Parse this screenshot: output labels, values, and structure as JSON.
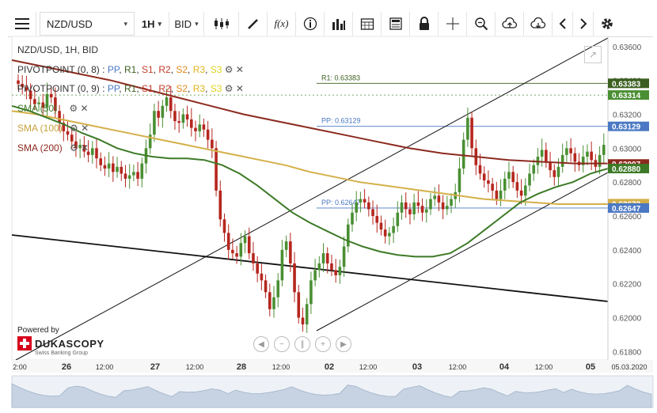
{
  "toolbar": {
    "symbol": "NZD/USD",
    "timeframe": "1H",
    "price_side": "BID",
    "fx_label": "f(x)",
    "buttons": [
      "menu-icon",
      "candles-icon",
      "pencil-icon",
      "fx-icon",
      "info-icon",
      "bars-icon",
      "calendar-icon",
      "report-icon",
      "lock-icon",
      "crosshair-icon",
      "zoom-icon",
      "upload-icon",
      "download-icon",
      "prev-icon",
      "next-icon",
      "settings-icon"
    ]
  },
  "legend": {
    "instrument": "NZD/USD, 1H, BID",
    "pivot1": {
      "name": "PIVOTPOINT (0, 8)",
      "items": [
        "PP",
        "R1",
        "S1",
        "R2",
        "S2",
        "R3",
        "S3"
      ]
    },
    "pivot2": {
      "name": "PIVOTPOINT (0, 9)",
      "items": [
        "PP",
        "R1",
        "S1",
        "R2",
        "S2",
        "R3",
        "S3"
      ]
    },
    "sma50": "SMA (50)",
    "sma100": "SMA (100)",
    "sma200": "SMA (200)"
  },
  "branding": {
    "powered_by": "Powered by",
    "name": "DUKASCOPY",
    "tagline": "Swiss Banking Group"
  },
  "colors": {
    "up": "#4a8f33",
    "down": "#b5261e",
    "sma50": "#3d7a27",
    "sma100": "#d4b04a",
    "sma200": "#8c2a1e",
    "pivot": "#4a78c4",
    "r1": "#3a5f1e"
  },
  "chart_data": {
    "type": "candlestick",
    "title": "NZD/USD, 1H, BID",
    "ylim": [
      0.6175,
      0.6366
    ],
    "yticks": [
      "0.63600",
      "0.63400",
      "0.63200",
      "0.63000",
      "0.62800",
      "0.62600",
      "0.62400",
      "0.62200",
      "0.62000",
      "0.61800"
    ],
    "xticks": [
      "2:00",
      "26",
      "12:00",
      "27",
      "12:00",
      "28",
      "12:00",
      "02",
      "12:00",
      "03",
      "12:00",
      "04",
      "12:00",
      "05",
      "05.03.2020"
    ],
    "price_tags": [
      {
        "value": "0.63383",
        "color": "#3a5f1e"
      },
      {
        "value": "0.63314",
        "color": "#4a8f33"
      },
      {
        "value": "0.63129",
        "color": "#4a78c4"
      },
      {
        "value": "0.62907",
        "color": "#8c2a1e"
      },
      {
        "value": "0.62880",
        "color": "#3d7a27"
      },
      {
        "value": "0.62673",
        "color": "#d4b04a"
      },
      {
        "value": "0.62647",
        "color": "#4a78c4"
      }
    ],
    "levels": [
      {
        "label": "R1: 0.63383",
        "value": 0.63383
      },
      {
        "label": "PP: 0.63129",
        "value": 0.63129
      },
      {
        "label": "PP: 0.62647",
        "value": 0.62647
      }
    ],
    "current_price": 0.63314,
    "closes": [
      0.6338,
      0.6336,
      0.6334,
      0.6329,
      0.6326,
      0.6327,
      0.6324,
      0.6332,
      0.633,
      0.6322,
      0.6315,
      0.631,
      0.6308,
      0.6304,
      0.63,
      0.6302,
      0.6298,
      0.6296,
      0.63,
      0.6294,
      0.629,
      0.6288,
      0.6291,
      0.6286,
      0.6289,
      0.6285,
      0.6282,
      0.6284,
      0.6286,
      0.6282,
      0.6291,
      0.63,
      0.6308,
      0.6322,
      0.6318,
      0.6325,
      0.633,
      0.6322,
      0.6316,
      0.6315,
      0.632,
      0.6317,
      0.6312,
      0.631,
      0.6314,
      0.6311,
      0.6305,
      0.63,
      0.6275,
      0.6258,
      0.625,
      0.624,
      0.6238,
      0.6236,
      0.6244,
      0.6248,
      0.6238,
      0.6232,
      0.6226,
      0.6222,
      0.6215,
      0.6205,
      0.6212,
      0.6222,
      0.624,
      0.6245,
      0.6232,
      0.6215,
      0.62,
      0.6196,
      0.6208,
      0.6222,
      0.6228,
      0.6232,
      0.6238,
      0.6232,
      0.6228,
      0.6225,
      0.623,
      0.6242,
      0.6255,
      0.6262,
      0.6268,
      0.627,
      0.6268,
      0.6264,
      0.626,
      0.6256,
      0.6252,
      0.6248,
      0.625,
      0.6254,
      0.6262,
      0.6268,
      0.6264,
      0.6261,
      0.6268,
      0.6266,
      0.6262,
      0.6264,
      0.627,
      0.6272,
      0.6268,
      0.6264,
      0.6266,
      0.627,
      0.6274,
      0.6288,
      0.6305,
      0.6318,
      0.63,
      0.629,
      0.6285,
      0.6281,
      0.6279,
      0.6275,
      0.627,
      0.6275,
      0.6282,
      0.6286,
      0.628,
      0.6275,
      0.6272,
      0.6278,
      0.6285,
      0.629,
      0.6295,
      0.6299,
      0.6292,
      0.6287,
      0.6283,
      0.6289,
      0.6296,
      0.63,
      0.6297,
      0.6292,
      0.629,
      0.6295,
      0.6298,
      0.6293,
      0.6289,
      0.6296,
      0.6302
    ],
    "sma50": [
      0.6325,
      0.6322,
      0.6318,
      0.6314,
      0.6309,
      0.6305,
      0.63,
      0.6297,
      0.6295,
      0.6294,
      0.6294,
      0.6293,
      0.629,
      0.6285,
      0.6278,
      0.627,
      0.6262,
      0.6256,
      0.6251,
      0.6246,
      0.6242,
      0.6239,
      0.6237,
      0.6236,
      0.6236,
      0.6238,
      0.6244,
      0.6252,
      0.626,
      0.6268,
      0.6273,
      0.6277,
      0.628,
      0.6285,
      0.6288
    ],
    "sma100": [
      0.6322,
      0.632,
      0.6317,
      0.6314,
      0.6311,
      0.6308,
      0.6305,
      0.6302,
      0.6299,
      0.6296,
      0.6293,
      0.629,
      0.6286,
      0.6283,
      0.628,
      0.6278,
      0.6276,
      0.6274,
      0.6272,
      0.627,
      0.6269,
      0.6268,
      0.6267,
      0.6267,
      0.6267
    ],
    "sma200": [
      0.6352,
      0.6348,
      0.6344,
      0.634,
      0.6335,
      0.633,
      0.6325,
      0.632,
      0.6316,
      0.6312,
      0.6308,
      0.6304,
      0.63,
      0.6297,
      0.6295,
      0.6293,
      0.6292,
      0.6291,
      0.6291
    ]
  }
}
